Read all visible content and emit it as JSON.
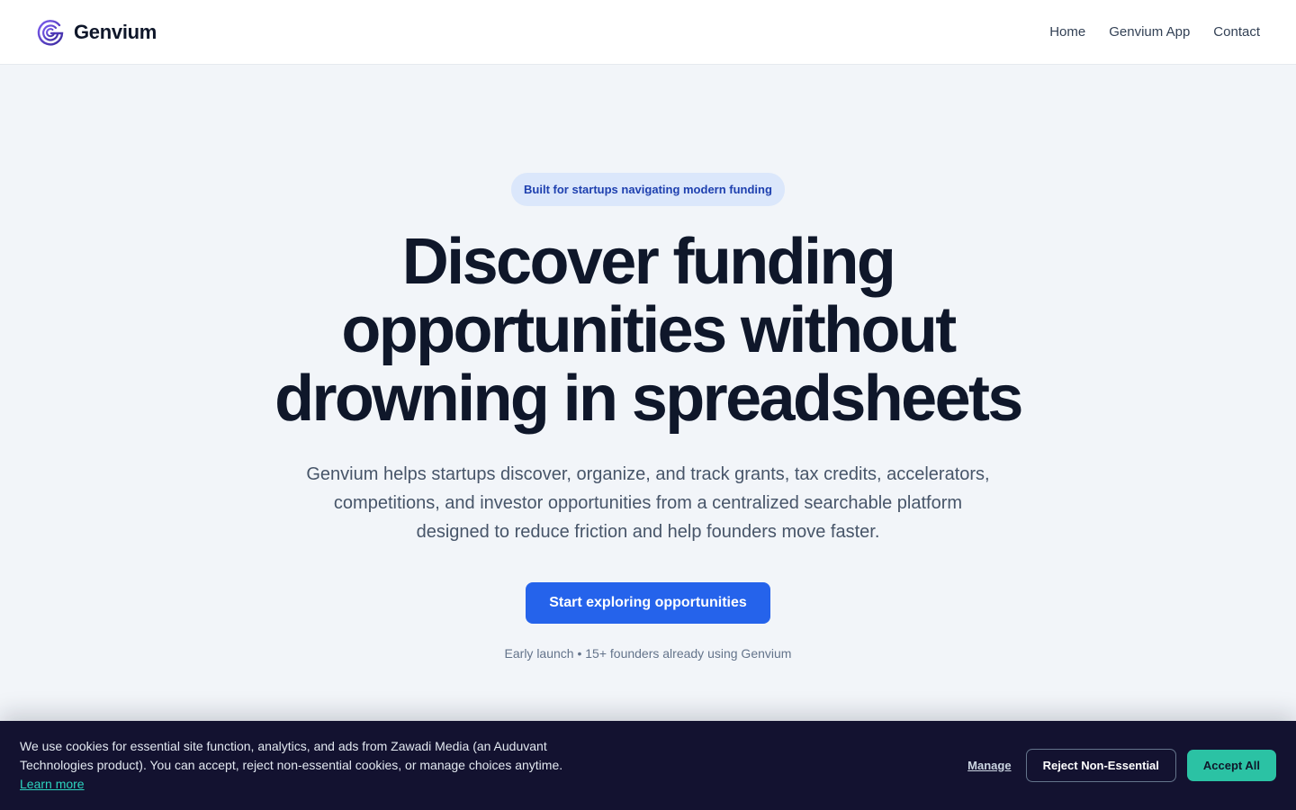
{
  "header": {
    "brand_name": "Genvium",
    "logo_icon": "genvium-logo-icon",
    "nav": [
      {
        "label": "Home"
      },
      {
        "label": "Genvium App"
      },
      {
        "label": "Contact"
      }
    ]
  },
  "hero": {
    "badge": "Built for startups navigating modern funding",
    "headline": "Discover funding opportunities without drowning in spreadsheets",
    "subtext": "Genvium helps startups discover, organize, and track grants, tax credits, accelerators, competitions, and investor opportunities from a centralized searchable platform designed to reduce friction and help founders move faster.",
    "cta_label": "Start exploring opportunities",
    "note": "Early launch • 15+ founders already using Genvium"
  },
  "cookie_banner": {
    "text": "We use cookies for essential site function, analytics, and ads from Zawadi Media (an Auduvant Technologies product). You can accept, reject non-essential cookies, or manage choices anytime.",
    "learn_more": "Learn more",
    "manage": "Manage",
    "reject": "Reject Non-Essential",
    "accept": "Accept All"
  },
  "colors": {
    "brand_blue": "#2563eb",
    "accept_teal": "#2bc2a4",
    "banner_bg": "#131230",
    "logo_purple": "#5b3cc4"
  }
}
